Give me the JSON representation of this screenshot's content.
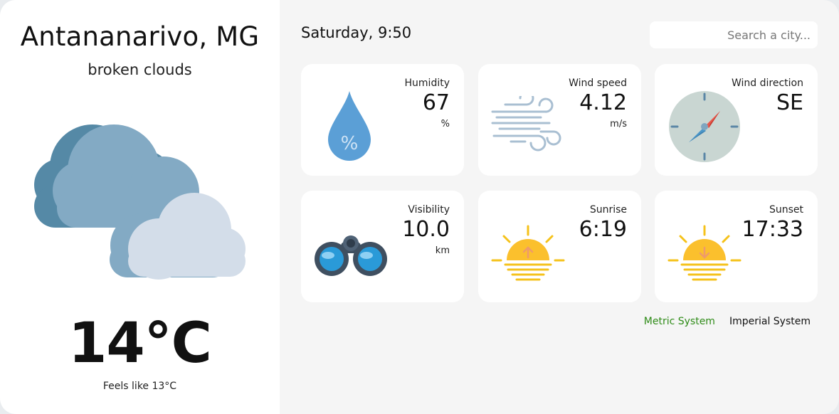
{
  "location": {
    "city": "Antananarivo, MG",
    "description": "broken clouds",
    "weather_icon": "broken-clouds-icon"
  },
  "current": {
    "temperature": "14°C",
    "feels_like": "Feels like 13°C"
  },
  "header": {
    "datetime": "Saturday, 9:50",
    "search_placeholder": "Search a city..."
  },
  "cards": {
    "humidity": {
      "label": "Humidity",
      "value": "67",
      "unit": "%",
      "icon": "humidity-drop-icon"
    },
    "wind_speed": {
      "label": "Wind speed",
      "value": "4.12",
      "unit": "m/s",
      "icon": "wind-icon"
    },
    "wind_direction": {
      "label": "Wind direction",
      "value": "SE",
      "icon": "compass-icon"
    },
    "visibility": {
      "label": "Visibility",
      "value": "10.0",
      "unit": "km",
      "icon": "binoculars-icon"
    },
    "sunrise": {
      "label": "Sunrise",
      "value": "6:19",
      "icon": "sunrise-icon"
    },
    "sunset": {
      "label": "Sunset",
      "value": "17:33",
      "icon": "sunset-icon"
    }
  },
  "units": {
    "metric_label": "Metric System",
    "imperial_label": "Imperial System",
    "selected": "metric"
  },
  "colors": {
    "active_unit": "#2e8b17",
    "panel_bg": "#f5f5f5",
    "card_bg": "#ffffff"
  }
}
